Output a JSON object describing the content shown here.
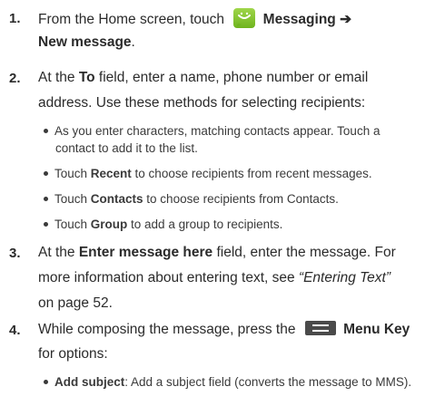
{
  "steps": [
    {
      "number": "1.",
      "line1_pre": "From the Home screen, touch",
      "icon": "messaging-smiley-icon",
      "line1_bold": "Messaging ➔",
      "line2_bold": "New message",
      "line2_post": "."
    },
    {
      "number": "2.",
      "line1_pre": "At the",
      "line1_bold": "To",
      "line1_post": " field, enter a name, phone number or email",
      "line2": "address. Use these methods for selecting recipients:",
      "bullets": [
        {
          "text": "As you enter characters, matching contacts appear. Touch a",
          "cont": "contact to add it to the list."
        },
        {
          "pre": "Touch ",
          "bold": "Recent",
          "post": " to choose recipients from recent messages."
        },
        {
          "pre": "Touch ",
          "bold": "Contacts",
          "post": " to choose recipients from Contacts."
        },
        {
          "pre": "Touch ",
          "bold": "Group",
          "post": " to add a group to recipients."
        }
      ]
    },
    {
      "number": "3.",
      "line1_pre": "At the",
      "line1_bold": "Enter message here",
      "line1_post": " field, enter the message. For",
      "line2_pre": "more information about entering text, see ",
      "line2_italic": "“Entering Text”",
      "line3": "on page 52."
    },
    {
      "number": "4.",
      "line1_pre": "While composing the message, press the",
      "icon": "menu-key-icon",
      "line1_bold": "Menu Key",
      "line2": "for options:",
      "bullets": [
        {
          "bold": "Add subject",
          "post": ": Add a subject field (converts the message to MMS)."
        }
      ]
    }
  ]
}
